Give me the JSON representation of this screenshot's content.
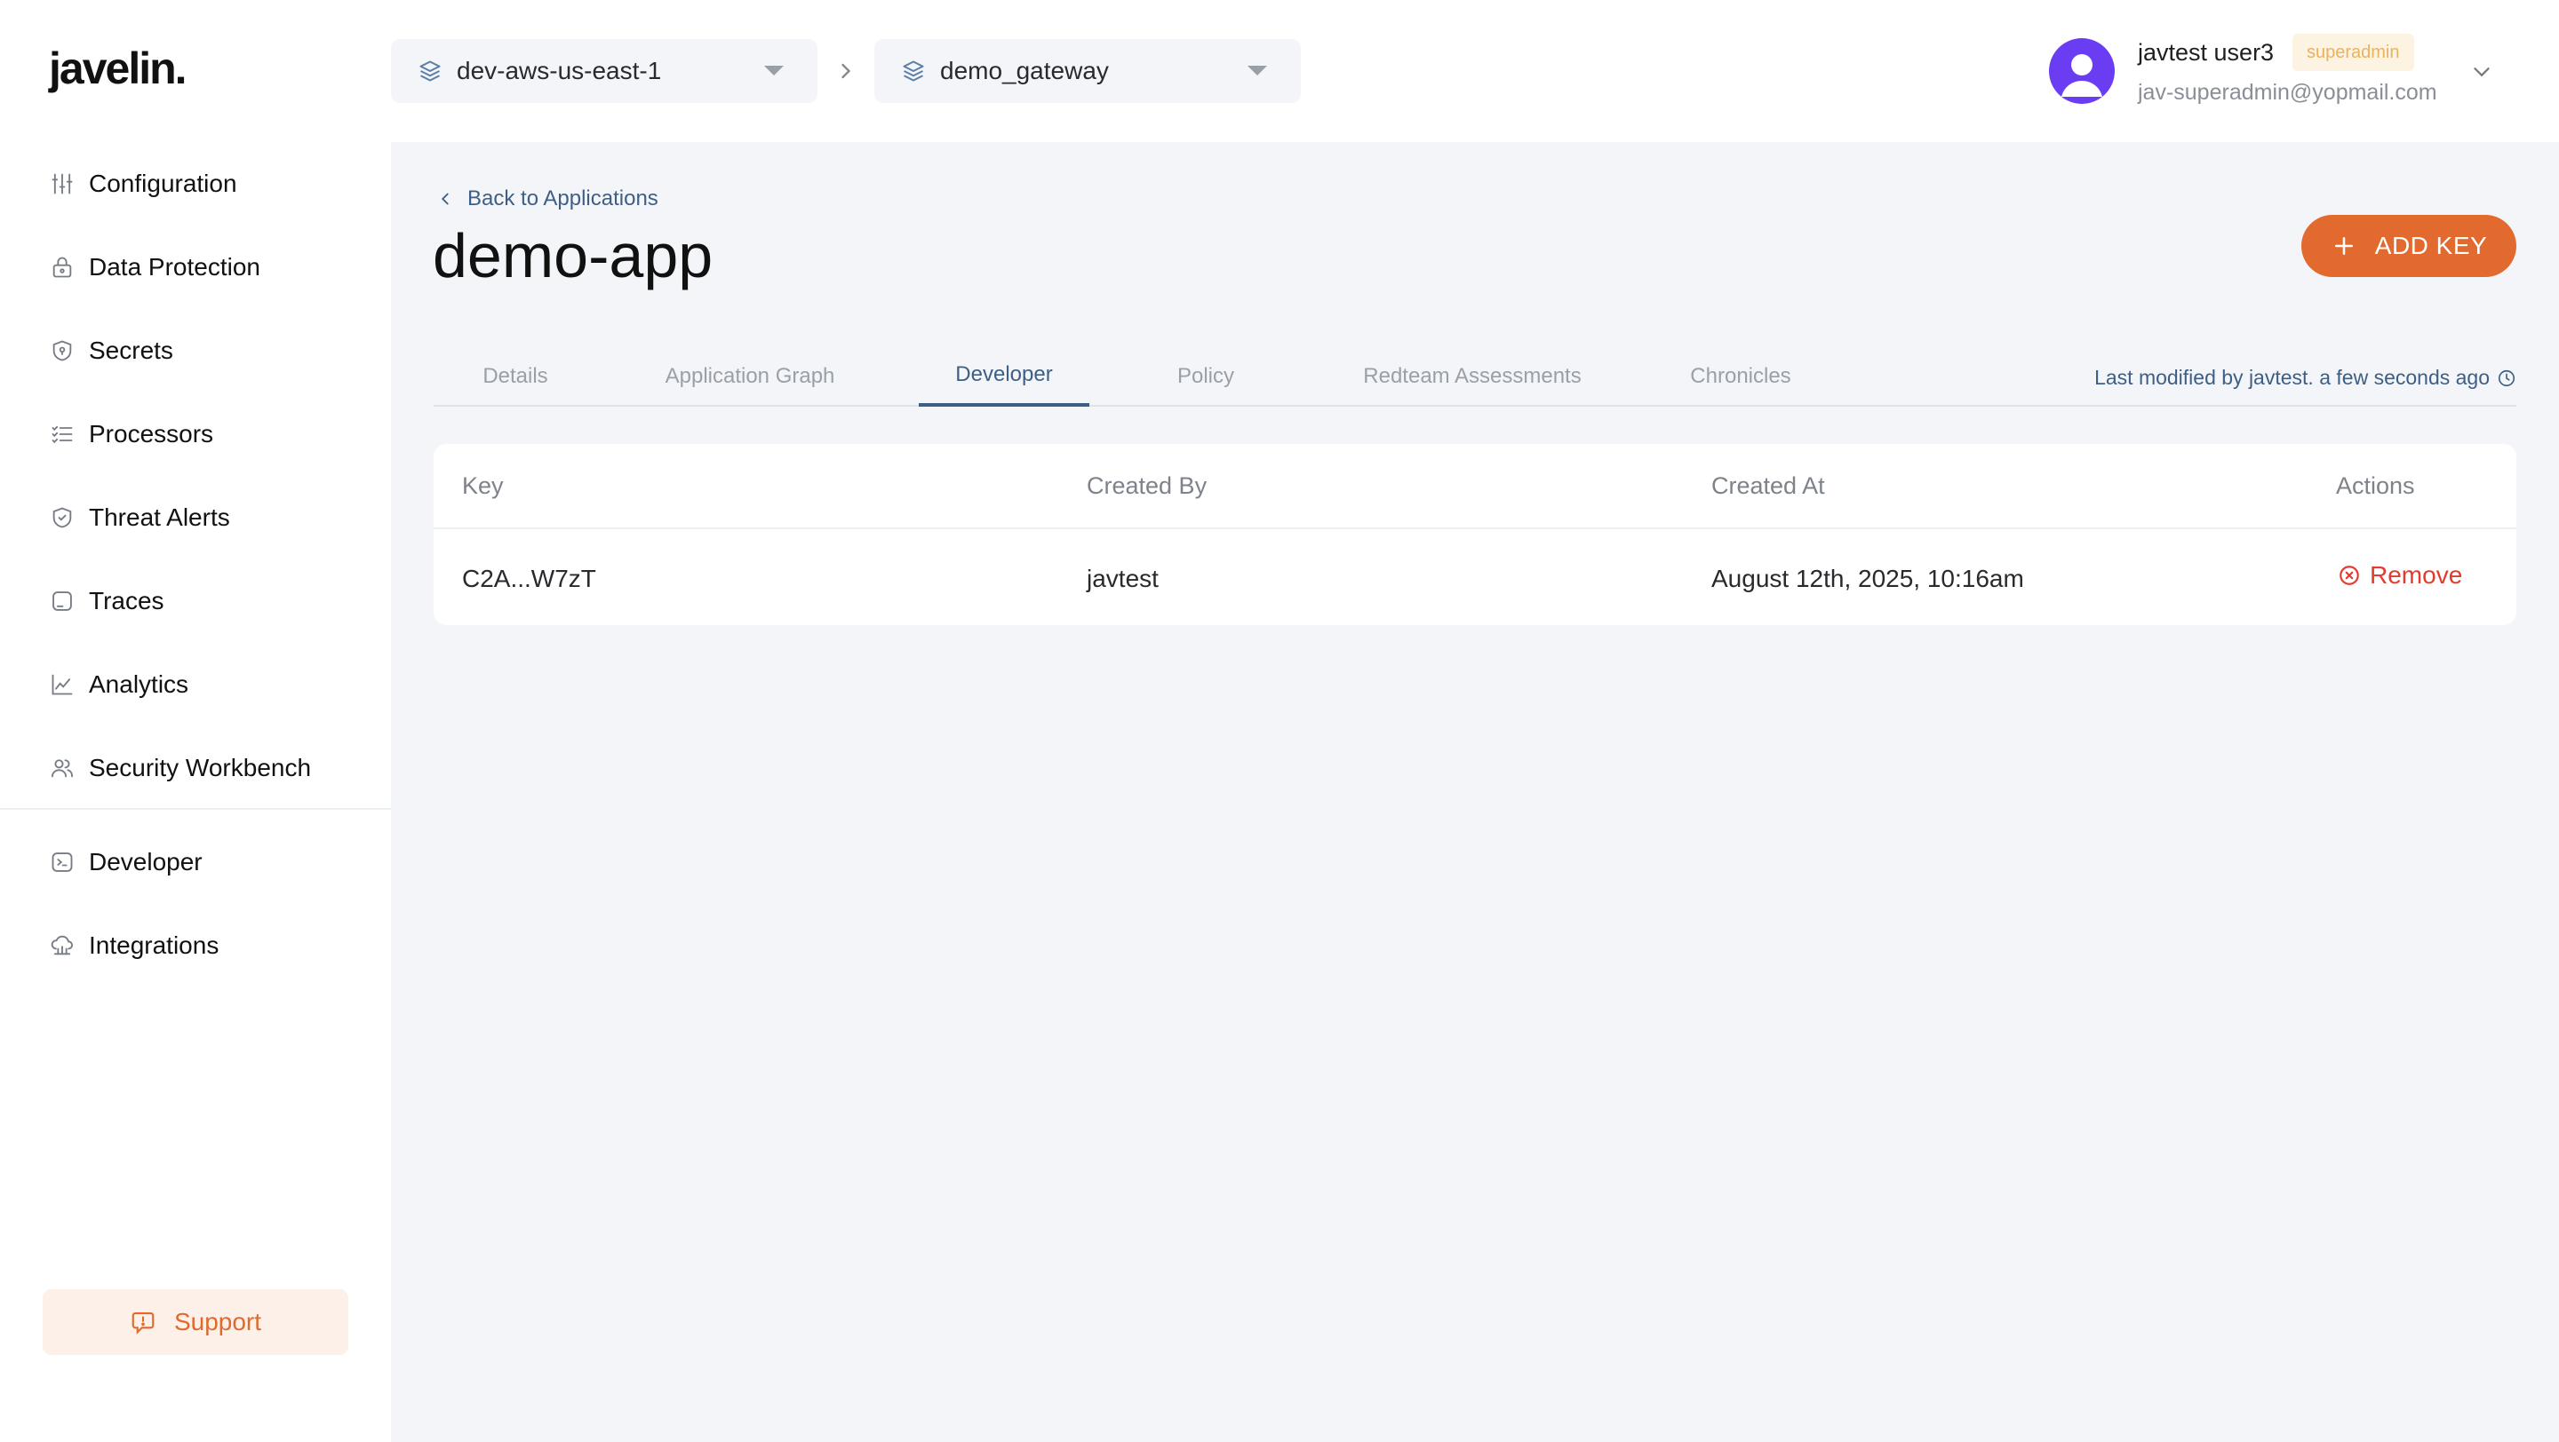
{
  "app": {
    "logo": "javelin."
  },
  "sidebar": {
    "items": [
      {
        "label": "Configuration",
        "icon": "sliders-icon"
      },
      {
        "label": "Data Protection",
        "icon": "lock-icon"
      },
      {
        "label": "Secrets",
        "icon": "shield-key-icon"
      },
      {
        "label": "Processors",
        "icon": "list-check-icon"
      },
      {
        "label": "Threat Alerts",
        "icon": "shield-check-icon"
      },
      {
        "label": "Traces",
        "icon": "square-icon"
      },
      {
        "label": "Analytics",
        "icon": "line-chart-icon"
      },
      {
        "label": "Security Workbench",
        "icon": "users-icon"
      }
    ],
    "secondary_items": [
      {
        "label": "Developer",
        "icon": "terminal-icon"
      },
      {
        "label": "Integrations",
        "icon": "cloud-icon"
      }
    ],
    "support_label": "Support"
  },
  "header": {
    "environment": "dev-aws-us-east-1",
    "gateway": "demo_gateway",
    "user": {
      "name": "javtest user3",
      "role": "superadmin",
      "email": "jav-superadmin@yopmail.com"
    }
  },
  "main": {
    "back_label": "Back to Applications",
    "title": "demo-app",
    "add_key_label": "ADD KEY",
    "tabs": [
      {
        "label": "Details",
        "active": false
      },
      {
        "label": "Application Graph",
        "active": false
      },
      {
        "label": "Developer",
        "active": true
      },
      {
        "label": "Policy",
        "active": false
      },
      {
        "label": "Redteam Assessments",
        "active": false
      },
      {
        "label": "Chronicles",
        "active": false
      }
    ],
    "last_modified": "Last modified by javtest. a few seconds ago",
    "table": {
      "columns": [
        "Key",
        "Created By",
        "Created At",
        "Actions"
      ],
      "rows": [
        {
          "key": "C2A...W7zT",
          "created_by": "javtest",
          "created_at": "August 12th, 2025, 10:16am",
          "action": "Remove"
        }
      ]
    }
  },
  "colors": {
    "accent": "#e26a2e",
    "link": "#3d5f86",
    "danger": "#e23b2f",
    "avatar": "#6a3df2"
  }
}
